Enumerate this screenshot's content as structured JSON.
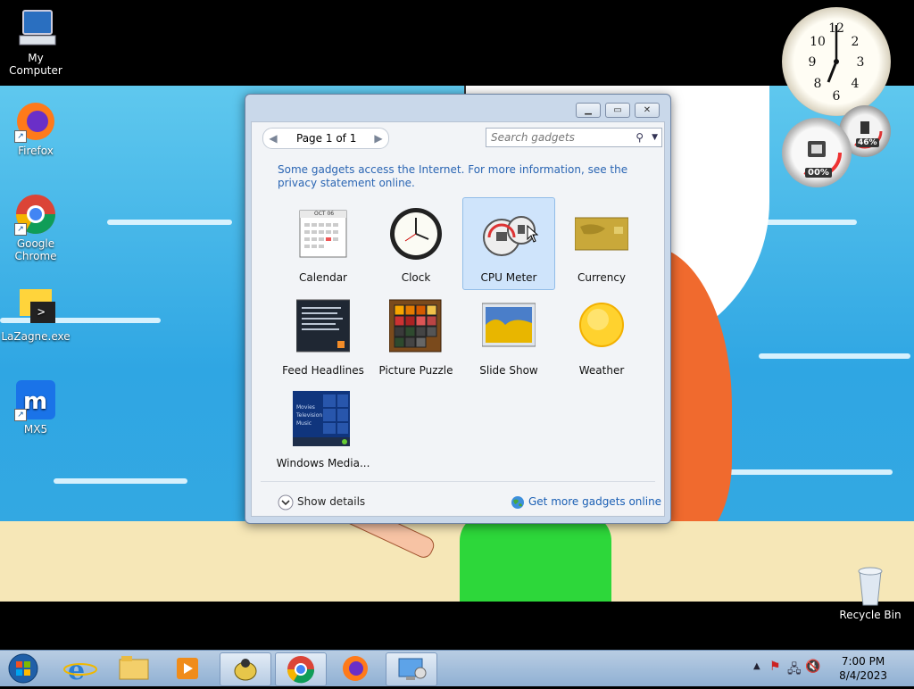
{
  "desktop": {
    "icons": [
      {
        "label": "My Computer"
      },
      {
        "label": "Firefox"
      },
      {
        "label": "Google Chrome"
      },
      {
        "label": "LaZagne.exe"
      },
      {
        "label": "MX5"
      },
      {
        "label": "Recycle Bin"
      }
    ]
  },
  "gadget_window": {
    "page_label": "Page 1 of 1",
    "search_placeholder": "Search gadgets",
    "info_text": "Some gadgets access the Internet.  For more information, see the privacy statement online.",
    "gadgets": [
      {
        "label": "Calendar",
        "selected": false
      },
      {
        "label": "Clock",
        "selected": false
      },
      {
        "label": "CPU Meter",
        "selected": true
      },
      {
        "label": "Currency",
        "selected": false
      },
      {
        "label": "Feed Headlines",
        "selected": false
      },
      {
        "label": "Picture Puzzle",
        "selected": false
      },
      {
        "label": "Slide Show",
        "selected": false
      },
      {
        "label": "Weather",
        "selected": false
      },
      {
        "label": "Windows Media...",
        "selected": false
      }
    ],
    "calendar_month": "OCT 06",
    "show_details": "Show details",
    "get_more": "Get more gadgets online"
  },
  "side_gadgets": {
    "cpu_percent": "00%",
    "mem_percent": "46%"
  },
  "taskbar": {
    "time": "7:00 PM",
    "date": "8/4/2023"
  }
}
